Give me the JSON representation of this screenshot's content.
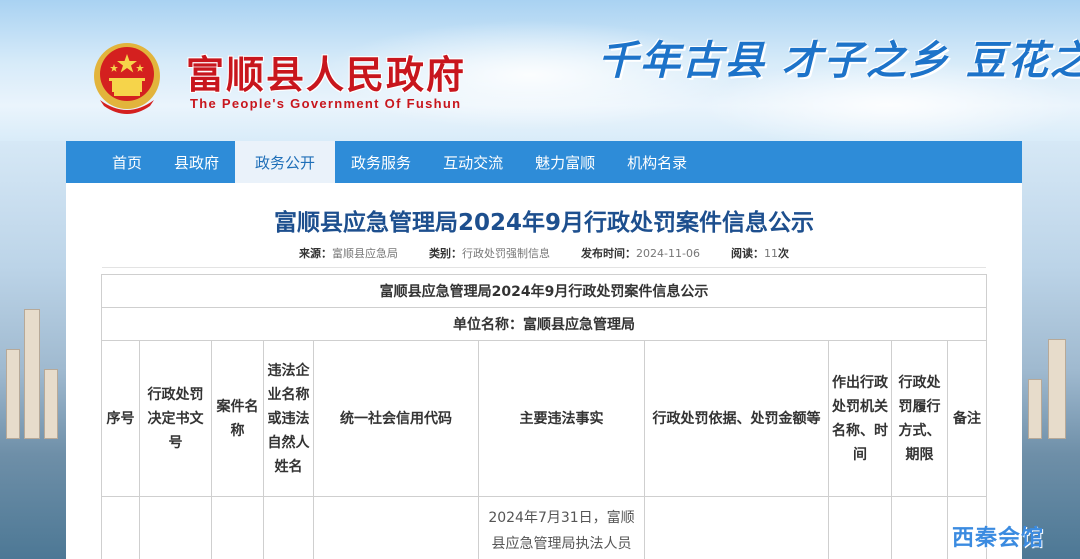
{
  "header": {
    "site_title": "富顺县人民政府",
    "site_subtitle": "The People's Government Of Fushun",
    "slogan": "千年古县  才子之乡  豆花之"
  },
  "nav": {
    "items": [
      {
        "label": "首页"
      },
      {
        "label": "县政府"
      },
      {
        "label": "政务公开",
        "active": true
      },
      {
        "label": "政务服务"
      },
      {
        "label": "互动交流"
      },
      {
        "label": "魅力富顺"
      },
      {
        "label": "机构名录"
      }
    ]
  },
  "article": {
    "title": "富顺县应急管理局2024年9月行政处罚案件信息公示",
    "meta": {
      "source_label": "来源：",
      "source": "富顺县应急局",
      "category_label": "类别：",
      "category": "行政处罚强制信息",
      "date_label": "发布时间：",
      "date": "2024-11-06",
      "views_label": "阅读：",
      "views": "11",
      "views_unit": "次"
    }
  },
  "table": {
    "caption": "富顺县应急管理局2024年9月行政处罚案件信息公示",
    "unit": "单位名称：富顺县应急管理局",
    "headers": [
      "序号",
      "行政处罚决定书文号",
      "案件名称",
      "违法企业名称或违法自然人姓名",
      "统一社会信用代码",
      "主要违法事实",
      "行政处罚依据、处罚金额等",
      "作出行政处罚机关名称、时间",
      "行政处罚履行方式、期限",
      "备注"
    ],
    "first_row_fact": "2024年7月31日，富顺县应急管理局执法人员"
  },
  "watermark": "西秦会馆"
}
